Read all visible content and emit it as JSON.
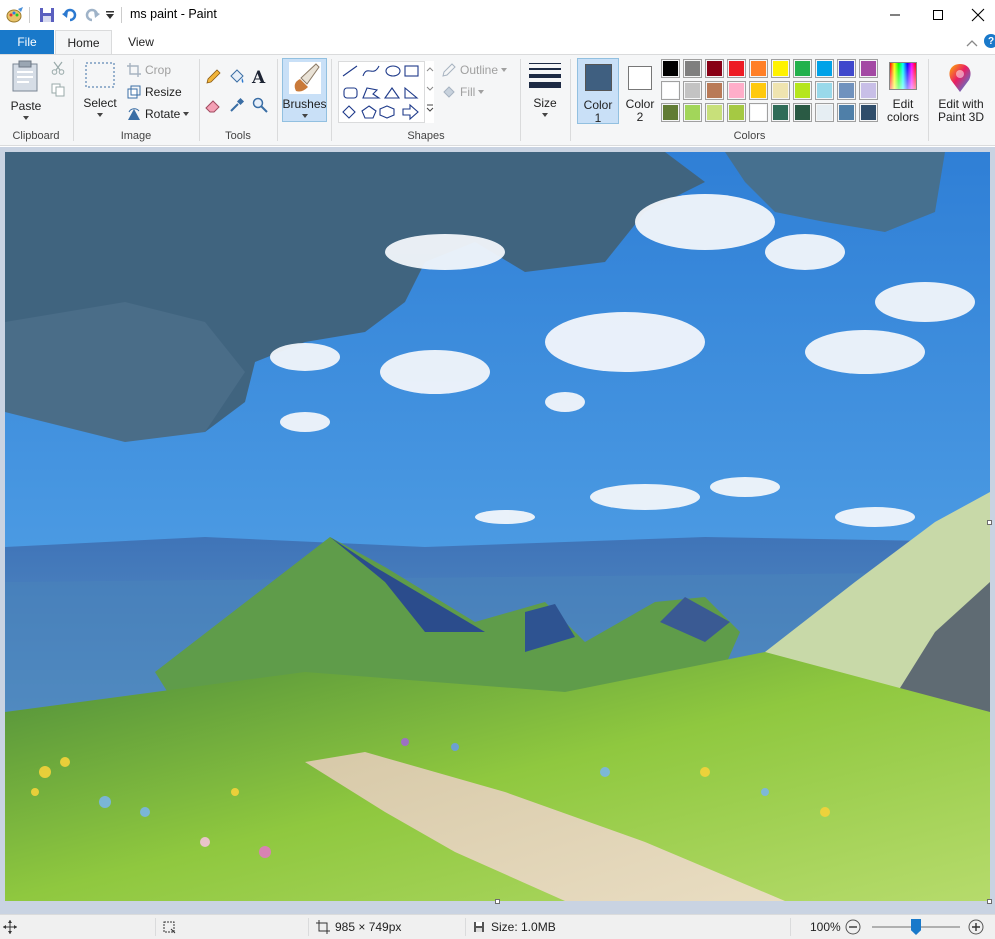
{
  "window": {
    "title": "ms paint - Paint"
  },
  "tabs": {
    "file": "File",
    "home": "Home",
    "view": "View"
  },
  "clipboard": {
    "paste": "Paste",
    "label": "Clipboard"
  },
  "image": {
    "select": "Select",
    "crop": "Crop",
    "resize": "Resize",
    "rotate": "Rotate",
    "label": "Image"
  },
  "tools": {
    "label": "Tools"
  },
  "brushes": {
    "label": "Brushes"
  },
  "shapes": {
    "outline": "Outline",
    "fill": "Fill",
    "label": "Shapes"
  },
  "size": {
    "label": "Size"
  },
  "colors": {
    "color1_line1": "Color",
    "color1_line2": "1",
    "color2_line1": "Color",
    "color2_line2": "2",
    "edit_line1": "Edit",
    "edit_line2": "colors",
    "label": "Colors",
    "color1_value": "#3f5f80",
    "color2_value": "#ffffff",
    "palette_row1": [
      "#000000",
      "#7f7f7f",
      "#880015",
      "#ed1c24",
      "#ff7f27",
      "#fff200",
      "#22b14c",
      "#00a2e8",
      "#3f48cc",
      "#a349a4"
    ],
    "palette_row2": [
      "#ffffff",
      "#c3c3c3",
      "#b97a57",
      "#ffaec9",
      "#ffc90e",
      "#efe4b0",
      "#b5e61d",
      "#99d9ea",
      "#7092be",
      "#c8bfe7"
    ],
    "palette_row3": [
      "#617c34",
      "#a2d65a",
      "#c8e07a",
      "#a5c943",
      "#ffffff",
      "#2f6c58",
      "#2a5a44",
      "#e6eef3",
      "#4f7fa8",
      "#2f4d6a"
    ]
  },
  "paint3d": {
    "line1": "Edit with",
    "line2": "Paint 3D"
  },
  "status": {
    "dimensions": "985 × 749px",
    "filesize": "Size: 1.0MB",
    "zoom": "100%",
    "zoom_level": 0.5
  }
}
